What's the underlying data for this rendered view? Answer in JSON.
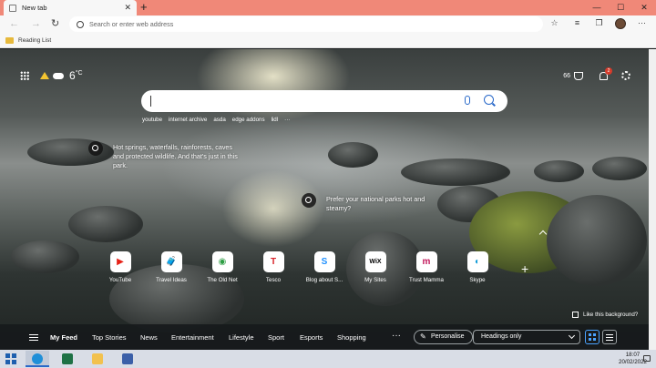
{
  "browser": {
    "tab_title": "New tab",
    "tab_close": "✕",
    "new_tab_symbol": "+",
    "window_controls": [
      "—",
      "☐",
      "✕"
    ],
    "address_placeholder": "Search or enter web address",
    "favorites": [
      "Reading List"
    ]
  },
  "page": {
    "temperature": "6",
    "temperature_unit": "°C",
    "rewards_points": "66",
    "notification_count": "2",
    "search_suggestions": [
      "youtube",
      "internet archive",
      "asda",
      "edge addons",
      "lidl",
      "···"
    ],
    "facts": [
      "Hot springs, waterfalls, rainforests, caves and protected wildlife. And that's just in this park.",
      "Prefer your national parks hot and steamy?"
    ],
    "quick_links": [
      {
        "label": "YouTube",
        "icon": "youtube-icon",
        "glyph": "▶",
        "color": "#e62117"
      },
      {
        "label": "Travel Ideas",
        "icon": "luggage-icon",
        "glyph": "🧳",
        "color": "#1a73e8"
      },
      {
        "label": "The Old Net",
        "icon": "globe-icon",
        "glyph": "◉",
        "color": "#2e9e44"
      },
      {
        "label": "Tesco",
        "icon": "tesco-icon",
        "glyph": "T",
        "color": "#d8232a"
      },
      {
        "label": "Blog about S...",
        "icon": "skype-icon",
        "glyph": "S",
        "color": "#1e90ff"
      },
      {
        "label": "My Sites",
        "icon": "wix-icon",
        "glyph": "WiX",
        "color": "#000000"
      },
      {
        "label": "Trust Mamma",
        "icon": "trustmamma-icon",
        "glyph": "m",
        "color": "#c2185b"
      },
      {
        "label": "Skype",
        "icon": "edge-icon",
        "glyph": "◐",
        "color": "#0f9bd8"
      }
    ],
    "add_tile_symbol": "+",
    "like_background": "Like this background?"
  },
  "feed": {
    "tabs": [
      "My Feed",
      "Top Stories",
      "News",
      "Entertainment",
      "Lifestyle",
      "Sport",
      "Esports",
      "Shopping"
    ],
    "more": "···",
    "personalise_label": "Personalise",
    "layout_select": "Headings only"
  },
  "taskbar": {
    "time": "18:07",
    "date": "20/02/2022",
    "apps": [
      {
        "name": "taskbar-edge",
        "color": "#1f8fd8"
      },
      {
        "name": "taskbar-excel",
        "color": "#1e7145"
      },
      {
        "name": "taskbar-explorer",
        "color": "#f2c14e"
      },
      {
        "name": "taskbar-media",
        "color": "#3b5fa8"
      }
    ]
  }
}
